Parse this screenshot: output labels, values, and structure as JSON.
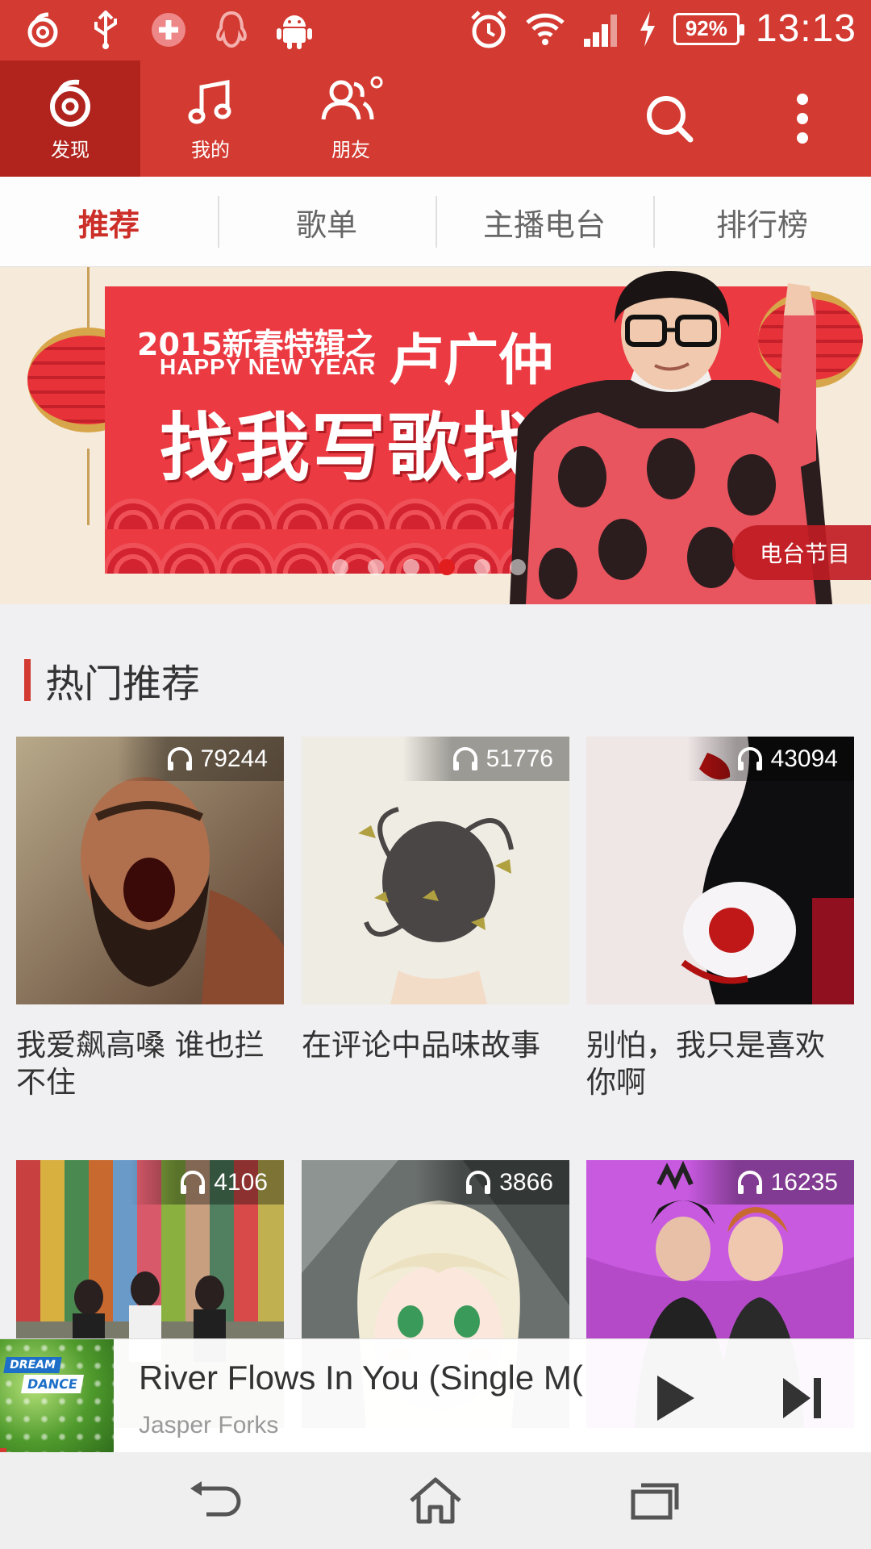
{
  "status_bar": {
    "battery": "92%",
    "time": "13:13"
  },
  "top_nav": {
    "tabs": [
      {
        "label": "发现",
        "icon": "netease-music-icon",
        "active": true
      },
      {
        "label": "我的",
        "icon": "music-note-icon",
        "active": false
      },
      {
        "label": "朋友",
        "icon": "friends-icon",
        "active": false
      }
    ]
  },
  "sub_tabs": [
    {
      "label": "推荐",
      "active": true
    },
    {
      "label": "歌单",
      "active": false
    },
    {
      "label": "主播电台",
      "active": false
    },
    {
      "label": "排行榜",
      "active": false
    }
  ],
  "banner": {
    "line1": "2015新春特辑之",
    "line1b": "HAPPY NEW YEAR",
    "name": "卢广仲",
    "slogan": "找我写歌找我玩!",
    "tag": "电台节目",
    "dot_count": 6,
    "active_dot": 3
  },
  "section": {
    "title": "热门推荐"
  },
  "playlists": [
    {
      "count": "79244",
      "title": "我爱飙高嗓 谁也拦不住"
    },
    {
      "count": "51776",
      "title": "在评论中品味故事"
    },
    {
      "count": "43094",
      "title": "别怕，我只是喜欢你啊"
    },
    {
      "count": "4106",
      "title": ""
    },
    {
      "count": "3866",
      "title": ""
    },
    {
      "count": "16235",
      "title": ""
    }
  ],
  "player": {
    "title": "River Flows In You (Single M(",
    "artist": "Jasper Forks",
    "art_text_1": "DREAM",
    "art_text_2": "DANCE"
  },
  "colors": {
    "brand_red": "#d33a31",
    "active_tab_red": "#b0241d",
    "accent_text_red": "#cc2e28"
  }
}
